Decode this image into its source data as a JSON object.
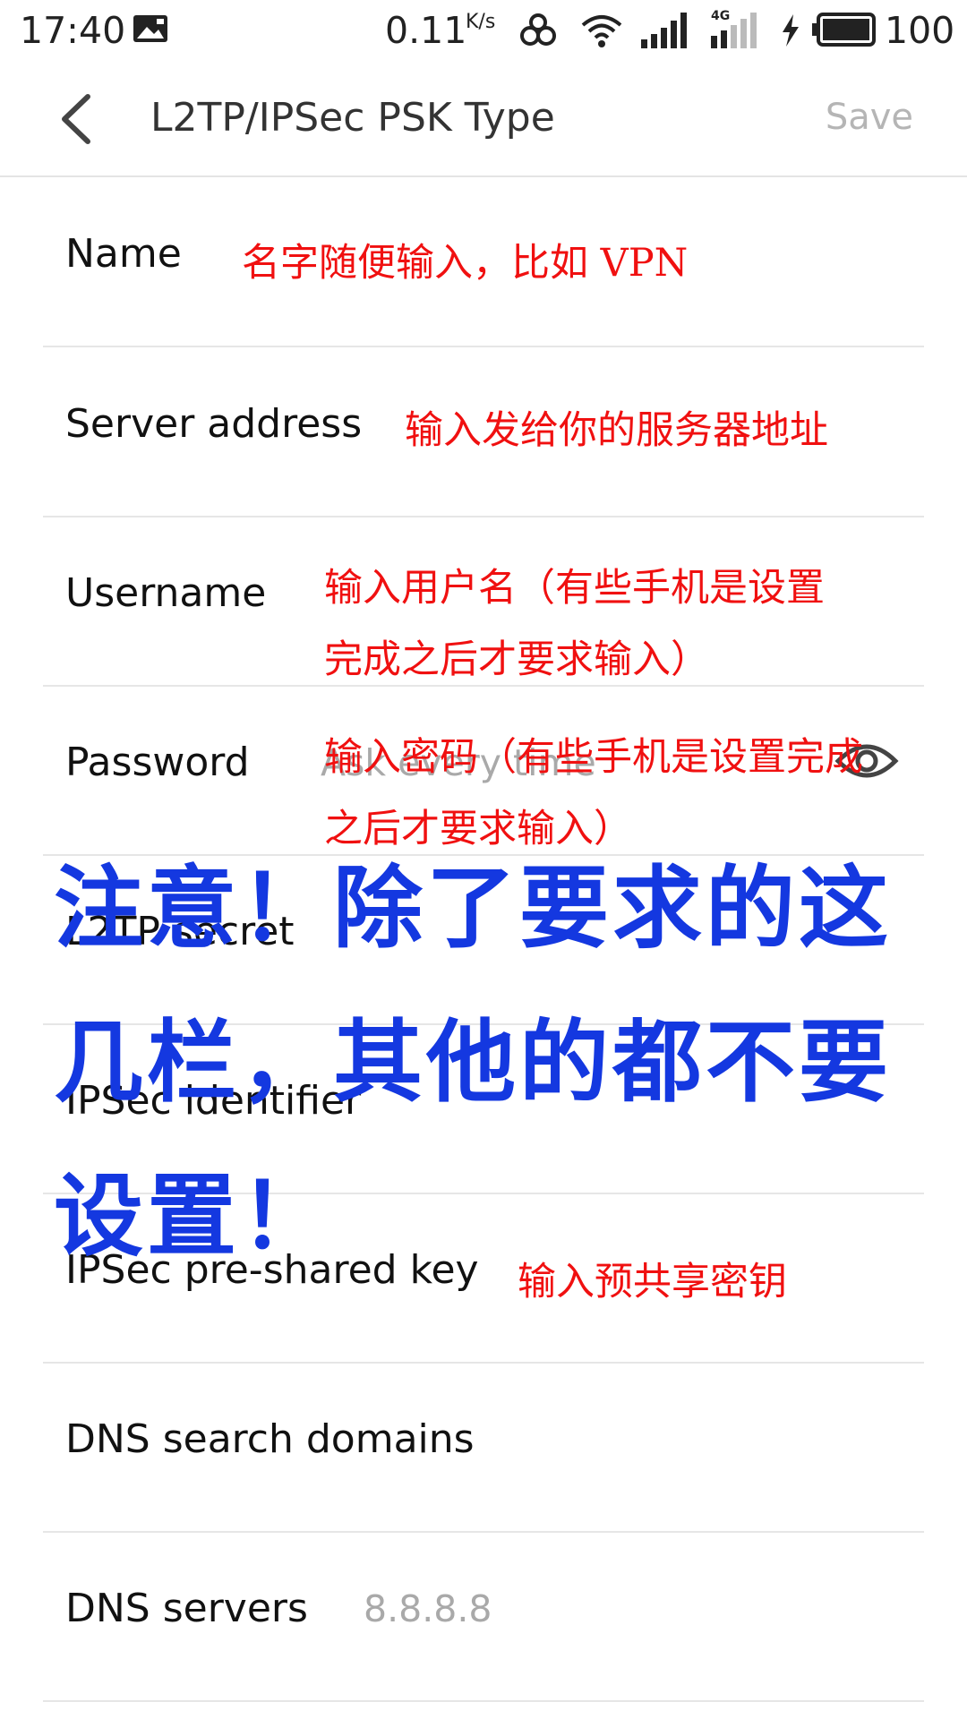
{
  "status_bar": {
    "time": "17:40",
    "net_speed": "0.11",
    "net_unit": "K/s",
    "network_type": "4G",
    "battery": "100",
    "icons": [
      "photo-icon",
      "link-icon",
      "wifi-icon",
      "signal-icon",
      "signal-icon",
      "charging-icon",
      "battery-icon"
    ]
  },
  "toolbar": {
    "back_icon": "chevron-left-icon",
    "title": "L2TP/IPSec PSK Type",
    "save_label": "Save",
    "save_color": "#b5b5b5"
  },
  "form": {
    "rows": [
      {
        "label": "Name",
        "value": ""
      },
      {
        "label": "Server address",
        "value": ""
      },
      {
        "label": "Username",
        "value": ""
      },
      {
        "label": "Password",
        "placeholder": "Ask every time",
        "icon": "eye-icon"
      },
      {
        "label": "L2TP secret",
        "value": ""
      },
      {
        "label": "IPSec identifier",
        "value": ""
      },
      {
        "label": "IPSec pre-shared key",
        "value": ""
      },
      {
        "label": "DNS search domains",
        "value": ""
      },
      {
        "label": "DNS servers",
        "placeholder": "8.8.8.8"
      }
    ]
  },
  "annotations": {
    "red_color": "#f01010",
    "blue_color": "#1438e0",
    "name": "名字随便输入，比如 VPN",
    "server": "输入发给你的服务器地址",
    "username_line1": "输入用户名（有些手机是设置",
    "username_line2": "完成之后才要求输入）",
    "password_line1": "输入密码（有些手机是设置完成",
    "password_line2": "之后才要求输入）",
    "psk": "输入预共享密钥",
    "warning_line1": "注意！除了要求的这",
    "warning_line2": "几栏，其他的都不要",
    "warning_line3": "设置！"
  }
}
